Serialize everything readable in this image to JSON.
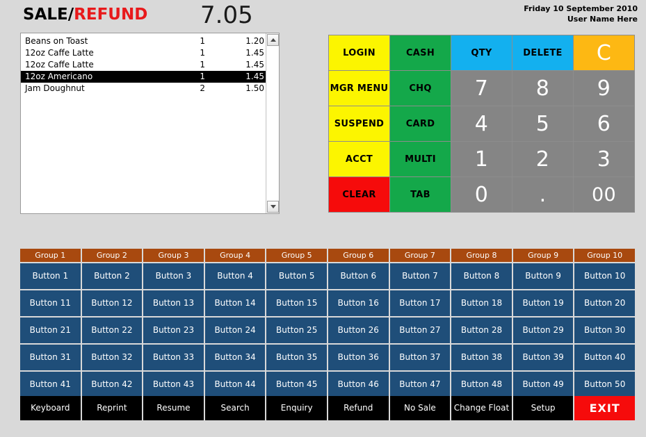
{
  "header": {
    "mode_sale": "SALE",
    "mode_separator": "/",
    "mode_refund": "REFUND",
    "total": "7.05",
    "date": "Friday 10 September  2010",
    "user": "User Name Here"
  },
  "receipt": {
    "items": [
      {
        "description": "Beans on Toast",
        "qty": "1",
        "price": "1.20",
        "selected": false
      },
      {
        "description": "12oz Caffe Latte",
        "qty": "1",
        "price": "1.45",
        "selected": false
      },
      {
        "description": "12oz Caffe Latte",
        "qty": "1",
        "price": "1.45",
        "selected": false
      },
      {
        "description": "12oz Americano",
        "qty": "1",
        "price": "1.45",
        "selected": true
      },
      {
        "description": "Jam Doughnut",
        "qty": "2",
        "price": "1.50",
        "selected": false
      }
    ],
    "scrollbar": {
      "up_icon": "triangle-up-icon",
      "down_icon": "triangle-down-icon"
    }
  },
  "keypad": {
    "keys": [
      {
        "label": "LOGIN",
        "style": "yellow"
      },
      {
        "label": "CASH",
        "style": "green"
      },
      {
        "label": "QTY",
        "style": "blue"
      },
      {
        "label": "DELETE",
        "style": "blue"
      },
      {
        "label": "C",
        "style": "orange"
      },
      {
        "label": "MGR MENU",
        "style": "yellow"
      },
      {
        "label": "CHQ",
        "style": "green"
      },
      {
        "label": "7",
        "style": "grey"
      },
      {
        "label": "8",
        "style": "grey"
      },
      {
        "label": "9",
        "style": "grey"
      },
      {
        "label": "SUSPEND",
        "style": "yellow"
      },
      {
        "label": "CARD",
        "style": "green"
      },
      {
        "label": "4",
        "style": "grey"
      },
      {
        "label": "5",
        "style": "grey"
      },
      {
        "label": "6",
        "style": "grey"
      },
      {
        "label": "ACCT",
        "style": "yellow"
      },
      {
        "label": "MULTI",
        "style": "green"
      },
      {
        "label": "1",
        "style": "grey"
      },
      {
        "label": "2",
        "style": "grey"
      },
      {
        "label": "3",
        "style": "grey"
      },
      {
        "label": "CLEAR",
        "style": "red"
      },
      {
        "label": "TAB",
        "style": "green"
      },
      {
        "label": "0",
        "style": "grey"
      },
      {
        "label": ".",
        "style": "grey"
      },
      {
        "label": "00",
        "style": "grey small"
      }
    ]
  },
  "product_grid": {
    "groups": [
      "Group 1",
      "Group 2",
      "Group 3",
      "Group 4",
      "Group 5",
      "Group 6",
      "Group 7",
      "Group 8",
      "Group 9",
      "Group 10"
    ],
    "rows": [
      [
        "Button 1",
        "Button 2",
        "Button 3",
        "Button 4",
        "Button 5",
        "Button 6",
        "Button 7",
        "Button 8",
        "Button 9",
        "Button 10"
      ],
      [
        "Button 11",
        "Button 12",
        "Button 13",
        "Button 14",
        "Button 15",
        "Button 16",
        "Button 17",
        "Button 18",
        "Button 19",
        "Button 20"
      ],
      [
        "Button 21",
        "Button 22",
        "Button 23",
        "Button 24",
        "Button 25",
        "Button 26",
        "Button 27",
        "Button 28",
        "Button 29",
        "Button 30"
      ],
      [
        "Button 31",
        "Button 32",
        "Button 33",
        "Button 34",
        "Button 35",
        "Button 36",
        "Button 37",
        "Button 38",
        "Button 39",
        "Button 40"
      ],
      [
        "Button 41",
        "Button 42",
        "Button 43",
        "Button 44",
        "Button 45",
        "Button 46",
        "Button 47",
        "Button 48",
        "Button 49",
        "Button 50"
      ]
    ]
  },
  "action_bar": {
    "actions": [
      {
        "label": "Keyboard",
        "style": ""
      },
      {
        "label": "Reprint",
        "style": ""
      },
      {
        "label": "Resume",
        "style": ""
      },
      {
        "label": "Search",
        "style": ""
      },
      {
        "label": "Enquiry",
        "style": ""
      },
      {
        "label": "Refund",
        "style": ""
      },
      {
        "label": "No Sale",
        "style": ""
      },
      {
        "label": "Change Float",
        "style": ""
      },
      {
        "label": "Setup",
        "style": ""
      },
      {
        "label": "EXIT",
        "style": "exit"
      }
    ]
  },
  "colors": {
    "background": "#d9d9d9",
    "refund_red": "#e8191b",
    "key_yellow": "#fcf500",
    "key_green": "#14a84a",
    "key_blue": "#13b0ef",
    "key_orange": "#fdb813",
    "key_red": "#f60b0b",
    "key_grey": "#858585",
    "group_header": "#a8490f",
    "product_button": "#1f4e79",
    "action_bar": "#000000"
  }
}
